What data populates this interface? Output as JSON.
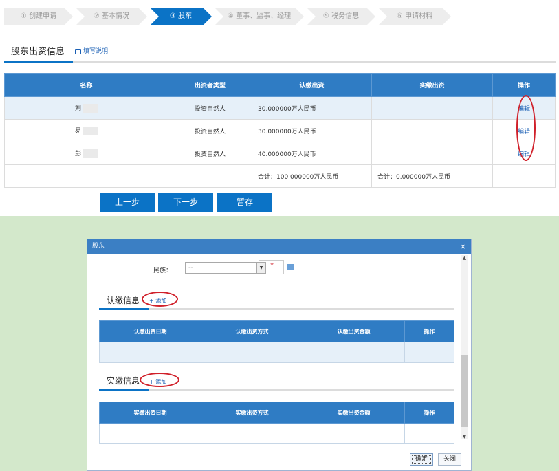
{
  "steps": [
    "① 创建申请",
    "② 基本情况",
    "③ 股东",
    "④ 董事、监事、经理",
    "⑤ 税务信息",
    "⑥ 申请材料"
  ],
  "section": {
    "title": "股东出资信息",
    "help": "填写说明"
  },
  "table": {
    "headers": [
      "名称",
      "出资者类型",
      "认缴出资",
      "实缴出资",
      "操作"
    ],
    "rows": [
      {
        "name": "刘",
        "type": "投资自然人",
        "subscribed": "30.000000万人民币",
        "paid": "",
        "action": "编辑"
      },
      {
        "name": "易",
        "type": "投资自然人",
        "subscribed": "30.000000万人民币",
        "paid": "",
        "action": "编辑"
      },
      {
        "name": "彭",
        "type": "投资自然人",
        "subscribed": "40.000000万人民币",
        "paid": "",
        "action": "编辑"
      }
    ],
    "total_subscribed": "合计：100.000000万人民币",
    "total_paid": "合计：0.000000万人民币"
  },
  "buttons": {
    "prev": "上一步",
    "next": "下一步",
    "save": "暂存"
  },
  "dialog": {
    "title": "股东",
    "close": "×",
    "ethnicity_label": "民族：",
    "ethnicity_value": "--",
    "required_mark": "*",
    "subscribed_section": {
      "title": "认缴信息",
      "add": "+ 添加",
      "headers": [
        "认缴出资日期",
        "认缴出资方式",
        "认缴出资金额",
        "操作"
      ]
    },
    "paid_section": {
      "title": "实缴信息",
      "add": "+ 添加",
      "headers": [
        "实缴出资日期",
        "实缴出资方式",
        "实缴出资金额",
        "操作"
      ]
    },
    "ok": "确定",
    "cancel": "关闭"
  },
  "colors": {
    "accent": "#0b73c6",
    "header": "#2f7cc4",
    "annotation": "#d0202a",
    "background": "#d3e8cb"
  }
}
